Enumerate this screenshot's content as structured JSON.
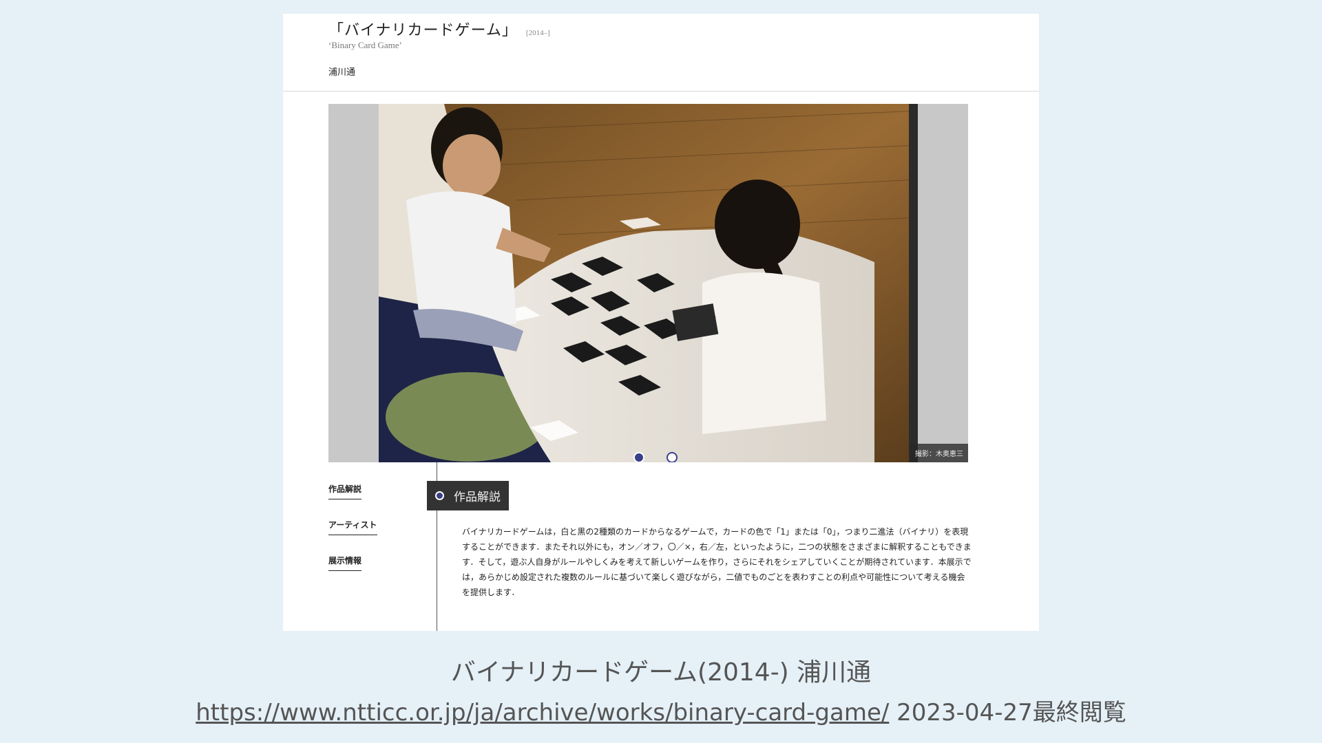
{
  "work": {
    "title_ja": "「バイナリカードゲーム」",
    "year": "[2014–]",
    "title_en": "‘Binary Card Game’",
    "artist": "浦川通"
  },
  "hero": {
    "photo_credit": "撮影：木奥恵三",
    "slide_count": 2,
    "active_slide": 1
  },
  "side_nav": {
    "items": [
      {
        "label": "作品解説"
      },
      {
        "label": "アーティスト"
      },
      {
        "label": "展示情報"
      }
    ]
  },
  "section": {
    "heading": "作品解説",
    "body": "バイナリカードゲームは，白と黒の2種類のカードからなるゲームで，カードの色で「1」または「0」，つまり二進法（バイナリ）を表現することができます．またそれ以外にも，オン／オフ，〇／×，右／左，といったように，二つの状態をさまざまに解釈することもできます．そして，遊ぶ人自身がルールやしくみを考えて新しいゲームを作り，さらにそれをシェアしていくことが期待されています．本展示では，あらかじめ設定された複数のルールに基づいて楽しく遊びながら，二値でものごとを表わすことの利点や可能性について考える機会を提供します．"
  },
  "caption": {
    "text": "バイナリカードゲーム(2014-) 浦川通",
    "url": "https://www.ntticc.or.jp/ja/archive/works/binary-card-game/",
    "accessed": "2023-04-27最終閲覧"
  },
  "colors": {
    "background": "#e5f0f7",
    "accent": "#3a3f8a",
    "tag_bg": "#333333"
  }
}
